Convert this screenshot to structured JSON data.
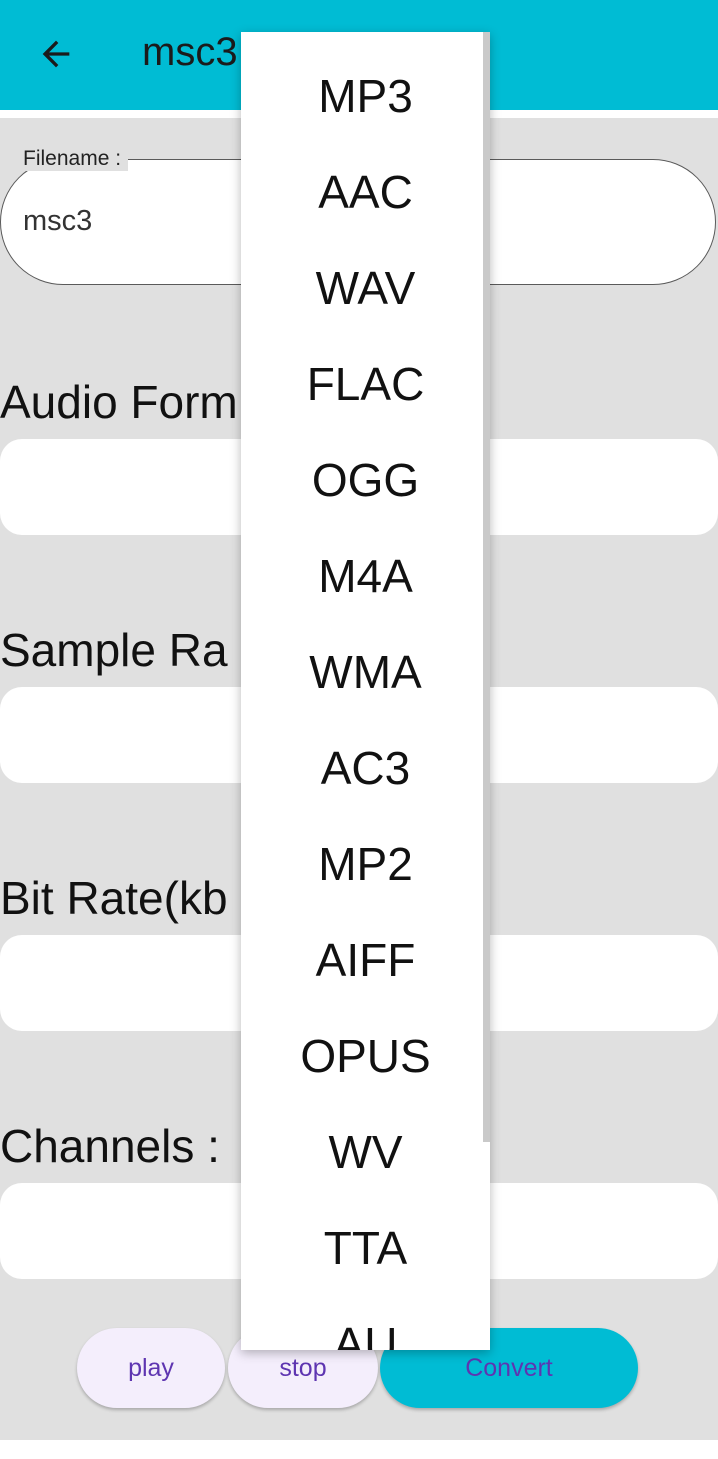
{
  "appbar": {
    "title": "msc3",
    "back_icon": "arrow-left-icon"
  },
  "filename": {
    "label": "Filename :",
    "value": "msc3"
  },
  "labels": {
    "audio_format": "Audio Form",
    "sample_rate": "Sample Ra",
    "bit_rate": "Bit Rate(kb",
    "channels": "Channels :"
  },
  "buttons": {
    "play": "play",
    "stop": "stop",
    "convert": "Convert"
  },
  "dropdown": {
    "options": [
      "MP3",
      "AAC",
      "WAV",
      "FLAC",
      "OGG",
      "M4A",
      "WMA",
      "AC3",
      "MP2",
      "AIFF",
      "OPUS",
      "WV",
      "TTA",
      "AU"
    ]
  },
  "colors": {
    "appbar": "#00bcd4",
    "background": "#e0e0e0",
    "button_text": "#5e35b1"
  }
}
